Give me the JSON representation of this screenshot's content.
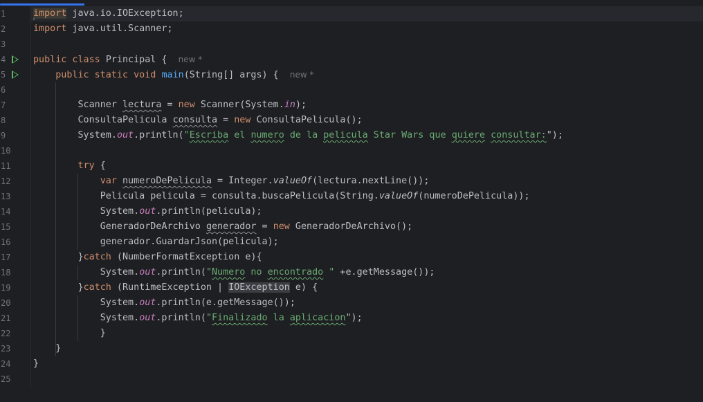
{
  "editor": {
    "language": "java",
    "tab_indicator_color": "#3574f0",
    "new_hint": "new *",
    "line_numbers": [
      "1",
      "2",
      "3",
      "4",
      "5",
      "6",
      "7",
      "8",
      "9",
      "10",
      "11",
      "12",
      "13",
      "14",
      "15",
      "16",
      "17",
      "18",
      "19",
      "20",
      "21",
      "22",
      "23",
      "24",
      "25"
    ],
    "tokens": {
      "import": "import",
      "io_import": " java.io.IOException;",
      "util_import": " java.util.Scanner;",
      "public": "public",
      "class": " class ",
      "class_name": "Principal {",
      "public_static_void": "public static void ",
      "main": "main",
      "main_params": "(String[] args) {",
      "scanner_decl": "Scanner ",
      "lectura": "lectura",
      "assign": " = ",
      "new": "new",
      "scanner_ctor": " Scanner(System.",
      "in": "in",
      "close_stmt": ");",
      "consulta_type": "ConsultaPelicula ",
      "consulta": "consulta",
      "consulta_ctor": " ConsultaPelicula();",
      "system": "System.",
      "out": "out",
      "println_open": ".println(",
      "q": "\"",
      "escriba": "Escriba",
      "el": " el ",
      "numero": "numero",
      "de_la": " de la ",
      "pelicula": "pelicula",
      "star_wars": " Star Wars que ",
      "quiere": "quiere",
      "consultar": "consultar:",
      "q_close_stmt": "\");",
      "try": "try",
      "brace_open": " {",
      "var": "var",
      "numero_var": "numeroDePelicula",
      "integer_value": " = Integer.",
      "valueOf": "valueOf",
      "nextline": "(lectura.nextLine());",
      "pelicula_line_a": "Pelicula pelicula = consulta.buscaPelicula(String.",
      "pelicula_line_b": "(numeroDePelicula));",
      "println_pelicula": ".println(pelicula);",
      "generador_type": "GeneradorDeArchivo ",
      "generador": "generador",
      "generador_ctor": " GeneradorDeArchivo();",
      "guardar": "generador.GuardarJson(pelicula);",
      "close_brace": "}",
      "catch": "catch",
      "nfe": " (NumberFormatException e){",
      "numero_cap": "Numero",
      "no": " no ",
      "encontrado": "encontrado",
      "msg_concat": " \" +e.getMessage());",
      "rte": " (RuntimeException | ",
      "ioexception": "IOException",
      "e_brace": " e) {",
      "println_msg": ".println(e.getMessage());",
      "finalizado": "Finalizado",
      "la": " la ",
      "aplicacion": "aplicacion"
    }
  }
}
